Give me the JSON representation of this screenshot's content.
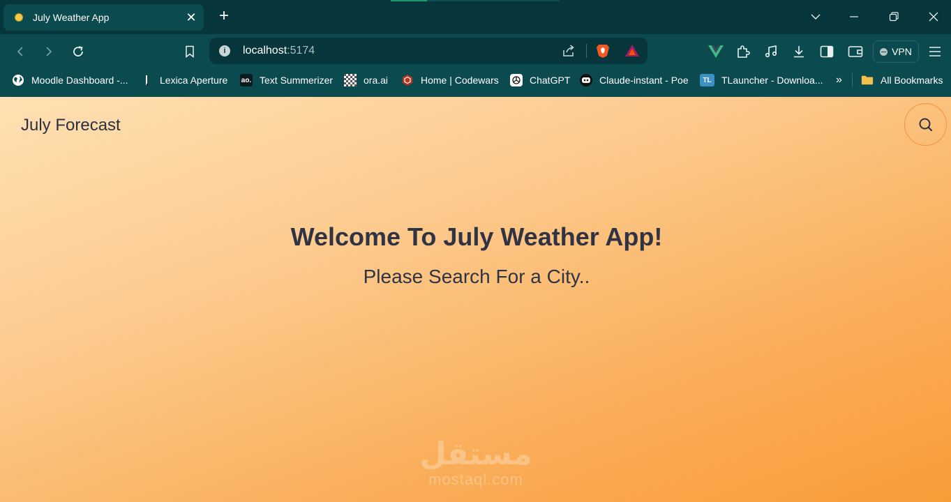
{
  "browser": {
    "tab": {
      "title": "July Weather App",
      "close_glyph": "✕"
    },
    "new_tab_glyph": "+",
    "window_controls": {
      "tab_search_glyph": "⌄",
      "minimize_glyph": "—",
      "restore_glyph": "❐",
      "close_glyph": "✕"
    },
    "toolbar": {
      "url_host": "localhost",
      "url_port": ":5174",
      "vpn_label": "VPN",
      "icons": [
        "back-icon",
        "forward-icon",
        "reload-icon",
        "bookmark-icon",
        "info-icon",
        "share-icon",
        "brave-shields-icon",
        "brave-rewards-icon",
        "vue-devtools-icon",
        "extensions-icon",
        "media-icon",
        "download-icon",
        "sidebar-icon",
        "wallet-icon",
        "menu-icon"
      ]
    },
    "bookmarks": [
      {
        "label": "Moodle Dashboard -...",
        "icon": "globe-icon"
      },
      {
        "label": "Lexica Aperture",
        "icon": "lexica-icon"
      },
      {
        "label": "Text Summerizer",
        "icon": "ao-icon"
      },
      {
        "label": "ora.ai",
        "icon": "ora-icon"
      },
      {
        "label": "Home | Codewars",
        "icon": "codewars-icon"
      },
      {
        "label": "ChatGPT",
        "icon": "chatgpt-icon"
      },
      {
        "label": "Claude-instant - Poe",
        "icon": "poe-icon"
      },
      {
        "label": "TLauncher - Downloa...",
        "icon": "tlauncher-icon"
      }
    ],
    "bookmarks_overflow": "»",
    "all_bookmarks": "All Bookmarks"
  },
  "page": {
    "app_title": "July Forecast",
    "heading": "Welcome To July Weather App!",
    "subtitle": "Please Search For a City..",
    "watermark_arabic": "مستقل",
    "watermark_latin": "mostaql.com"
  },
  "colors": {
    "tabstrip": "#06363b",
    "toolbar": "#0b4a4e",
    "gradient_start": "#ffe0b3",
    "gradient_end": "#f99b39",
    "text_dark": "#2f3344",
    "search_ring": "#f2943d"
  }
}
